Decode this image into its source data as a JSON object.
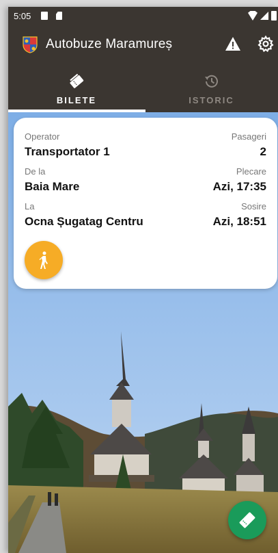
{
  "status_bar": {
    "time": "5:05"
  },
  "app_bar": {
    "title": "Autobuze Maramureș",
    "icons": {
      "logo": "county-crest-icon",
      "warning": "warning-icon",
      "settings": "gear-icon"
    }
  },
  "tabs": [
    {
      "label": "BILETE",
      "icon": "tickets-icon",
      "active": true
    },
    {
      "label": "ISTORIC",
      "icon": "history-icon",
      "active": false
    }
  ],
  "trip_card": {
    "operator_label": "Operator",
    "operator_value": "Transportator 1",
    "passengers_label": "Pasageri",
    "passengers_value": "2",
    "from_label": "De la",
    "from_value": "Baia Mare",
    "departure_label": "Plecare",
    "departure_value": "Azi, 17:35",
    "to_label": "La",
    "to_value": "Ocna Șugatag Centru",
    "arrival_label": "Sosire",
    "arrival_value": "Azi, 18:51"
  },
  "colors": {
    "app_bar": "#3b3631",
    "walk_fab": "#f6ac26",
    "ticket_fab": "#1a9b5a"
  }
}
